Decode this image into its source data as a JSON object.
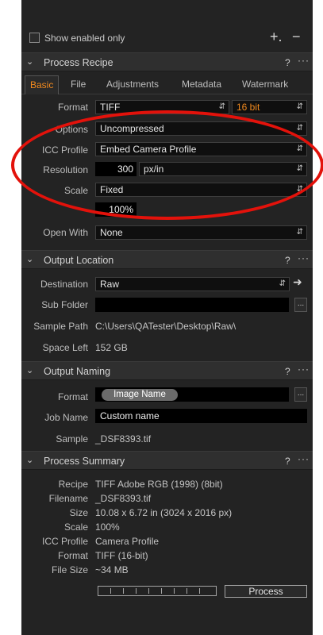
{
  "filter": {
    "show_enabled_label": "Show enabled only",
    "add": "+.",
    "remove": "−"
  },
  "recipe": {
    "title": "Process Recipe",
    "help": "?",
    "more": "···",
    "tabs": [
      "Basic",
      "File",
      "Adjustments",
      "Metadata",
      "Watermark"
    ],
    "format_label": "Format",
    "format_value": "TIFF",
    "bit_value": "16 bit",
    "options_label": "Options",
    "options_value": "Uncompressed",
    "icc_label": "ICC Profile",
    "icc_value": "Embed Camera Profile",
    "resolution_label": "Resolution",
    "resolution_value": "300",
    "resolution_unit": "px/in",
    "scale_label": "Scale",
    "scale_value": "Fixed",
    "scale_percent": "100%",
    "open_with_label": "Open With",
    "open_with_value": "None"
  },
  "location": {
    "title": "Output Location",
    "help": "?",
    "more": "···",
    "destination_label": "Destination",
    "destination_value": "Raw",
    "subfolder_label": "Sub Folder",
    "subfolder_value": "",
    "sample_path_label": "Sample Path",
    "sample_path_value": "C:\\Users\\QATester\\Desktop\\Raw\\",
    "space_left_label": "Space Left",
    "space_left_value": "152 GB"
  },
  "naming": {
    "title": "Output Naming",
    "help": "?",
    "more": "···",
    "format_label": "Format",
    "format_token": "Image Name",
    "job_name_label": "Job Name",
    "job_name_value": "Custom name",
    "sample_label": "Sample",
    "sample_value": "_DSF8393.tif"
  },
  "summary": {
    "title": "Process Summary",
    "help": "?",
    "more": "···",
    "rows": [
      {
        "label": "Recipe",
        "value": "TIFF Adobe RGB (1998) (8bit)"
      },
      {
        "label": "Filename",
        "value": "_DSF8393.tif"
      },
      {
        "label": "Size",
        "value": "10.08 x 6.72 in (3024 x 2016 px)"
      },
      {
        "label": "Scale",
        "value": "100%"
      },
      {
        "label": "ICC Profile",
        "value": "Camera Profile"
      },
      {
        "label": "Format",
        "value": "TIFF (16-bit)"
      },
      {
        "label": "File Size",
        "value": "~34 MB"
      }
    ],
    "process_label": "Process"
  },
  "icons": {
    "dropdown": "up-down-chevron-icon",
    "arrow_right": "arrow-right-icon",
    "ellipsis": "ellipsis-icon",
    "collapse": "chevron-down-icon"
  },
  "colors": {
    "accent": "#f28a1e",
    "annotation": "#e3120b",
    "panel": "#232323"
  }
}
